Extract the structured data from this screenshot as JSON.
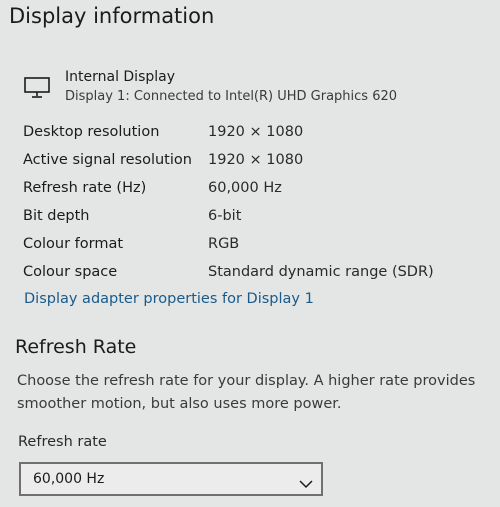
{
  "section_title": "Display information",
  "display": {
    "name": "Internal Display",
    "description": "Display 1: Connected to Intel(R) UHD Graphics 620",
    "icon": "monitor-icon"
  },
  "info_rows": [
    {
      "label": "Desktop resolution",
      "value": "1920 × 1080"
    },
    {
      "label": "Active signal resolution",
      "value": "1920 × 1080"
    },
    {
      "label": "Refresh rate (Hz)",
      "value": "60,000 Hz"
    },
    {
      "label": "Bit depth",
      "value": "6-bit"
    },
    {
      "label": "Colour format",
      "value": "RGB"
    },
    {
      "label": "Colour space",
      "value": "Standard dynamic range (SDR)"
    }
  ],
  "adapter_link": "Display adapter properties for Display 1",
  "refresh": {
    "title": "Refresh Rate",
    "description_line1": "Choose the refresh rate for your display. A higher rate provides",
    "description_line2": "smoother motion, but also uses more power.",
    "dropdown_label": "Refresh rate",
    "selected_value": "60,000 Hz",
    "dropdown_icon": "chevron-down-icon"
  },
  "colors": {
    "background": "#e4e6e5",
    "link": "#1a5a8a",
    "text": "#1b1b1b"
  }
}
